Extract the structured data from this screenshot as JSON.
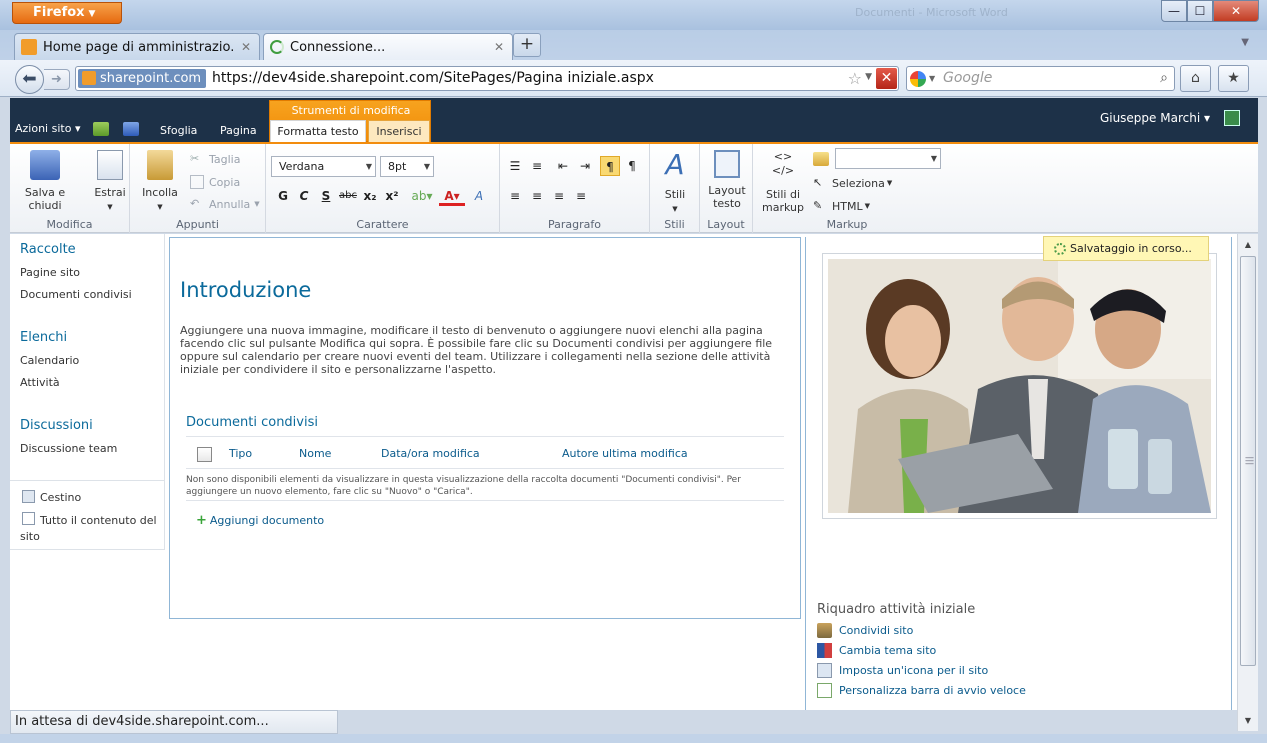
{
  "window": {
    "app_button": "Firefox",
    "ghost_title": "Documenti - Microsoft Word",
    "controls": {
      "minimize": "—",
      "maximize": "☐",
      "close": "✕"
    }
  },
  "tabs": [
    {
      "title": "Home page di amministrazio...",
      "state": "inactive"
    },
    {
      "title": "Connessione...",
      "state": "active, loading"
    }
  ],
  "navbar": {
    "identity": "sharepoint.com",
    "url": "https://dev4side.sharepoint.com/SitePages/Pagina iniziale.aspx",
    "search_placeholder": "Google"
  },
  "sp_top": {
    "site_actions": "Azioni sito",
    "tabs": [
      "Sfoglia",
      "Pagina"
    ],
    "context_group": "Strumenti di modifica",
    "context_tabs": [
      "Formatta testo",
      "Inserisci"
    ],
    "user": "Giuseppe Marchi"
  },
  "ribbon": {
    "groups": {
      "modifica": {
        "label": "Modifica",
        "save": "Salva e chiudi",
        "check_out": "Estrai"
      },
      "appunti": {
        "label": "Appunti",
        "paste": "Incolla",
        "cut": "Taglia",
        "copy": "Copia",
        "undo": "Annulla"
      },
      "carattere": {
        "label": "Carattere",
        "font": "Verdana",
        "size": "8pt",
        "bold": "G",
        "italic": "C",
        "underline": "S",
        "strike": "abc",
        "sub": "x₂",
        "sup": "x²"
      },
      "paragrafo": {
        "label": "Paragrafo"
      },
      "stili": {
        "label": "Stili",
        "styles": "Stili"
      },
      "layout": {
        "label": "Layout",
        "text_layout": "Layout\ntesto"
      },
      "markup": {
        "label": "Markup",
        "markup_styles": "Stili di\nmarkup",
        "select": "Seleziona",
        "html": "HTML"
      }
    }
  },
  "leftnav": {
    "sections": [
      {
        "heading": "Raccolte",
        "items": [
          "Pagine sito",
          "Documenti condivisi"
        ]
      },
      {
        "heading": "Elenchi",
        "items": [
          "Calendario",
          "Attività"
        ]
      },
      {
        "heading": "Discussioni",
        "items": [
          "Discussione team"
        ]
      }
    ],
    "recycle": "Cestino",
    "all_content": "Tutto il contenuto del sito"
  },
  "content": {
    "title": "Introduzione",
    "body": "Aggiungere una nuova immagine, modificare il testo di benvenuto o aggiungere nuovi elenchi alla pagina facendo clic sul pulsante Modifica qui sopra. È possibile fare clic su Documenti condivisi per aggiungere file oppure sul calendario per creare nuovi eventi del team. Utilizzare i collegamenti nella sezione delle attività iniziale per condividere il sito e personalizzarne l'aspetto.",
    "doclib": {
      "title": "Documenti condivisi",
      "columns": [
        "Tipo",
        "Nome",
        "Data/ora modifica",
        "Autore ultima modifica"
      ],
      "empty": "Non sono disponibili elementi da visualizzare in questa visualizzazione della raccolta documenti \"Documenti condivisi\". Per aggiungere un nuovo elemento, fare clic su \"Nuovo\" o \"Carica\".",
      "add": "Aggiungi documento"
    }
  },
  "right": {
    "saving": "Salvataggio in corso...",
    "tasks_title": "Riquadro attività iniziale",
    "tasks": [
      "Condividi sito",
      "Cambia tema sito",
      "Imposta un'icona per il sito",
      "Personalizza barra di avvio veloce"
    ]
  },
  "status": "In attesa di dev4side.sharepoint.com..."
}
